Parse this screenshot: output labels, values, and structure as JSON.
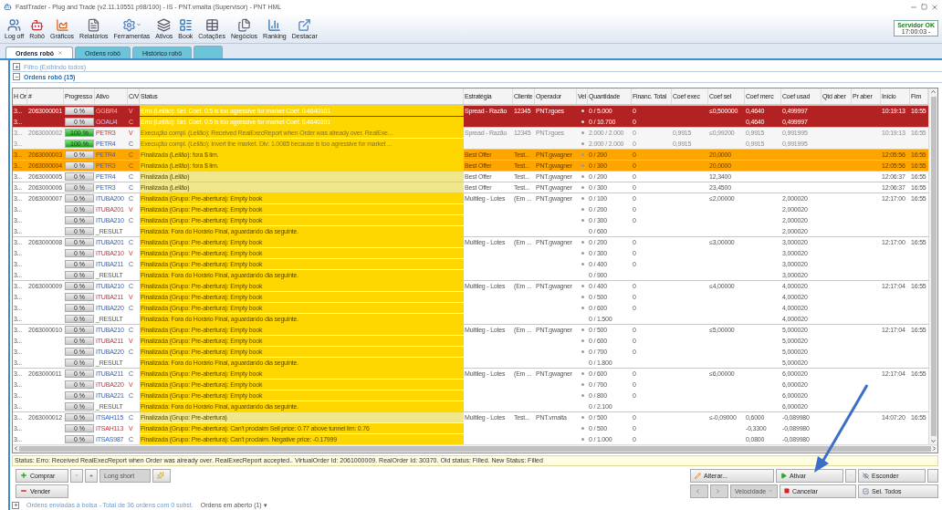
{
  "window": {
    "title": "FastTrader - Plug and Trade (v2.11.10551 p98/100) - IS - PNT.vmalta (Supervisor) - PNT HML"
  },
  "toolbar": [
    {
      "label": "Log off",
      "has_menu": false
    },
    {
      "label": "Robô",
      "has_menu": false
    },
    {
      "label": "Gráficos",
      "has_menu": false
    },
    {
      "label": "Relatórios",
      "has_menu": false
    },
    {
      "label": "Ferramentas",
      "has_menu": true
    },
    {
      "label": "Ativos",
      "has_menu": false
    },
    {
      "label": "Book",
      "has_menu": false
    },
    {
      "label": "Cotações",
      "has_menu": false
    },
    {
      "label": "Negócios",
      "has_menu": false
    },
    {
      "label": "Ranking",
      "has_menu": false
    },
    {
      "label": "Destacar",
      "has_menu": false
    }
  ],
  "server": {
    "status": "Servidor OK",
    "time": "17:00:03 -"
  },
  "tabs": [
    {
      "label": "Ordens robô",
      "selected": true,
      "closable": true
    },
    {
      "label": "Ordens robô",
      "selected": false,
      "closable": false
    },
    {
      "label": "Histórico robô",
      "selected": false,
      "closable": false
    }
  ],
  "filter": {
    "label": "Filtro (Exibindo todos)",
    "expanded": false
  },
  "orders_panel": {
    "label": "Ordens robô (15)",
    "expanded": true
  },
  "columns": [
    "H Or",
    "#",
    "Progresso",
    "Ativo",
    "C/V",
    "Status",
    "Estratégia",
    "Cliente",
    "Operador",
    "Vel",
    "Quantidade",
    "Financ. Total",
    "Coef exec",
    "Coef sel",
    "Coef merc",
    "Coef usad",
    "Qtd aber",
    "Pr aber",
    "Início",
    "Fim"
  ],
  "rows": [
    {
      "hash": "3...",
      "id": "2063000001",
      "level": 0,
      "progress": "0 %",
      "ativo": "GGBR4",
      "side": "V",
      "status": "Erro (Leilão): Sel. Coef. 0.5 is too agressive for market Coef. 0.4640101",
      "strategy": "Spread - Razão",
      "client": "12345",
      "operator": "PNT.rgoes",
      "vel": true,
      "qty": "0 / 5.000",
      "fin": "0",
      "coef_sel": "≤0,500000",
      "coef_merc": "0,4640",
      "coef_usad": "0,499997",
      "start": "10:19:13",
      "end": "16:55",
      "kind": "error",
      "status_pale": false,
      "group_start": true
    },
    {
      "hash": "3...",
      "level": 0,
      "progress": "0 %",
      "ativo": "GOAU4",
      "side": "C",
      "status": "Erro (Leilão): Sel. Coef. 0.5 is too agressive for market Coef. 0.4640101",
      "vel": true,
      "qty": "0 / 10.700",
      "fin": "0",
      "coef_merc": "0,4640",
      "coef_usad": "0,499997",
      "kind": "error",
      "status_pale": false,
      "group_start": false
    },
    {
      "hash": "3...",
      "id": "2063000002",
      "level": 1,
      "progress": "100 %",
      "ativo": "PETR3",
      "side": "V",
      "status": "Execução compl. (Leilão): Received RealExecReport when Order was already over. RealExe...",
      "strategy": "Spread - Razão",
      "client": "12345",
      "operator": "PNT.rgoes",
      "vel": true,
      "qty": "2.000 / 2.000",
      "fin": "0",
      "coef_exec": "0,9915",
      "coef_sel": "≤0,99200",
      "coef_merc": "0,9915",
      "coef_usad": "0,991995",
      "start": "10:19:13",
      "end": "16:55",
      "kind": "done",
      "status_pale": false,
      "group_start": true
    },
    {
      "hash": "3...",
      "level": 1,
      "progress": "100 %",
      "ativo": "PETR4",
      "side": "C",
      "status": "Execução compl. (Leilão): Invert the market. Div: 1.0085 because is too agressive for market ...",
      "vel": true,
      "qty": "2.000 / 2.000",
      "fin": "0",
      "coef_exec": "0,9915",
      "coef_merc": "0,9915",
      "coef_usad": "0,991995",
      "kind": "done",
      "status_pale": false,
      "group_start": false
    },
    {
      "hash": "3...",
      "id": "2063000003",
      "level": 0,
      "progress": "0 %",
      "ativo": "PETR4",
      "side": "C",
      "status": "Finalizada (Leilão): fora $ lim.",
      "strategy": "Best Offer",
      "client": "Test...",
      "operator": "PNT.gwagner",
      "vel": true,
      "qty": "0 / 200",
      "fin": "0",
      "coef_sel": "20,0000",
      "start": "12:05:56",
      "end": "16:55",
      "kind": "warning",
      "status_pale": false,
      "group_start": true
    },
    {
      "hash": "3...",
      "id": "2063000004",
      "level": 0,
      "progress": "0 %",
      "ativo": "PETR3",
      "side": "C",
      "status": "Finalizada (Leilão): fora $ lim.",
      "strategy": "Best Offer",
      "client": "Test...",
      "operator": "PNT.gwagner",
      "vel": true,
      "qty": "0 / 300",
      "fin": "0",
      "coef_sel": "20,0000",
      "start": "12:05:56",
      "end": "16:55",
      "kind": "warning",
      "status_pale": false,
      "group_start": true
    },
    {
      "hash": "3...",
      "id": "2063000005",
      "level": 0,
      "progress": "0 %",
      "ativo": "PETR4",
      "side": "C",
      "status": "Finalizada (Leilão)",
      "strategy": "Best Offer",
      "client": "Test...",
      "operator": "PNT.gwagner",
      "vel": true,
      "qty": "0 / 200",
      "fin": "0",
      "coef_sel": "12,3400",
      "start": "12:06:37",
      "end": "16:55",
      "kind": "normal",
      "status_pale": true,
      "group_start": true
    },
    {
      "hash": "3...",
      "id": "2063000006",
      "level": 0,
      "progress": "0 %",
      "ativo": "PETR3",
      "side": "C",
      "status": "Finalizada (Leilão)",
      "strategy": "Best Offer",
      "client": "Test...",
      "operator": "PNT.gwagner",
      "vel": true,
      "qty": "0 / 300",
      "fin": "0",
      "coef_sel": "23,4500",
      "start": "12:06:37",
      "end": "16:55",
      "kind": "normal",
      "status_pale": true,
      "group_start": true
    },
    {
      "hash": "3...",
      "id": "2063000007",
      "level": 0,
      "progress": "0 %",
      "ativo": "ITUBA200",
      "side": "C",
      "status": "Finalizada (Grupo: Pre-abertura): Empty book",
      "strategy": "Multileg - Lotes",
      "client": "(Em ...",
      "operator": "PNT.gwagner",
      "vel": true,
      "qty": "0 / 100",
      "fin": "0",
      "coef_sel": "≤2,00000",
      "coef_usad": "2,000020",
      "start": "12:17:00",
      "end": "16:55",
      "kind": "normal",
      "status_pale": false,
      "group_start": true
    },
    {
      "hash": "3...",
      "level": 0,
      "progress": "0 %",
      "ativo": "ITUBA201",
      "side": "V",
      "status": "Finalizada (Grupo: Pre-abertura): Empty book",
      "vel": true,
      "qty": "0 / 200",
      "fin": "0",
      "coef_usad": "2,000020",
      "kind": "normal",
      "status_pale": false,
      "group_start": false
    },
    {
      "hash": "3...",
      "level": 0,
      "progress": "0 %",
      "ativo": "ITUBA210",
      "side": "C",
      "status": "Finalizada (Grupo: Pre-abertura): Empty book",
      "vel": true,
      "qty": "0 / 300",
      "fin": "0",
      "coef_usad": "2,000020",
      "kind": "normal",
      "status_pale": false,
      "group_start": false
    },
    {
      "hash": "3...",
      "level": 0,
      "progress": "0 %",
      "ativo": "_RESULT",
      "status": "Finalizada: Fora do Horário Final, aguardando dia seguinte.",
      "vel": false,
      "qty": "0 / 600",
      "coef_usad": "2,000020",
      "kind": "normal",
      "status_pale": false,
      "group_start": false
    },
    {
      "hash": "3...",
      "id": "2063000008",
      "level": 0,
      "progress": "0 %",
      "ativo": "ITUBA201",
      "side": "C",
      "status": "Finalizada (Grupo: Pre-abertura): Empty book",
      "strategy": "Multileg - Lotes",
      "client": "(Em ...",
      "operator": "PNT.gwagner",
      "vel": true,
      "qty": "0 / 200",
      "fin": "0",
      "coef_sel": "≤3,00000",
      "coef_usad": "3,000020",
      "start": "12:17:00",
      "end": "16:55",
      "kind": "normal",
      "status_pale": false,
      "group_start": true
    },
    {
      "hash": "3...",
      "level": 0,
      "progress": "0 %",
      "ativo": "ITUBA210",
      "side": "V",
      "status": "Finalizada (Grupo: Pre-abertura): Empty book",
      "vel": true,
      "qty": "0 / 300",
      "fin": "0",
      "coef_usad": "3,000020",
      "kind": "normal",
      "status_pale": false,
      "group_start": false
    },
    {
      "hash": "3...",
      "level": 0,
      "progress": "0 %",
      "ativo": "ITUBA211",
      "side": "C",
      "status": "Finalizada (Grupo: Pre-abertura): Empty book",
      "vel": true,
      "qty": "0 / 400",
      "fin": "0",
      "coef_usad": "3,000020",
      "kind": "normal",
      "status_pale": false,
      "group_start": false
    },
    {
      "hash": "3...",
      "level": 0,
      "progress": "0 %",
      "ativo": "_RESULT",
      "status": "Finalizada: Fora do Horário Final, aguardando dia seguinte.",
      "vel": false,
      "qty": "0 / 900",
      "coef_usad": "3,000020",
      "kind": "normal",
      "status_pale": false,
      "group_start": false
    },
    {
      "hash": "3...",
      "id": "2063000009",
      "level": 0,
      "progress": "0 %",
      "ativo": "ITUBA210",
      "side": "C",
      "status": "Finalizada (Grupo: Pre-abertura): Empty book",
      "strategy": "Multileg - Lotes",
      "client": "(Em ...",
      "operator": "PNT.gwagner",
      "vel": true,
      "qty": "0 / 400",
      "fin": "0",
      "coef_sel": "≤4,00000",
      "coef_usad": "4,000020",
      "start": "12:17:04",
      "end": "16:55",
      "kind": "normal",
      "status_pale": false,
      "group_start": true
    },
    {
      "hash": "3...",
      "level": 0,
      "progress": "0 %",
      "ativo": "ITUBA211",
      "side": "V",
      "status": "Finalizada (Grupo: Pre-abertura): Empty book",
      "vel": true,
      "qty": "0 / 500",
      "fin": "0",
      "coef_usad": "4,000020",
      "kind": "normal",
      "status_pale": false,
      "group_start": false
    },
    {
      "hash": "3...",
      "level": 0,
      "progress": "0 %",
      "ativo": "ITUBA220",
      "side": "C",
      "status": "Finalizada (Grupo: Pre-abertura): Empty book",
      "vel": true,
      "qty": "0 / 600",
      "fin": "0",
      "coef_usad": "4,000020",
      "kind": "normal",
      "status_pale": false,
      "group_start": false
    },
    {
      "hash": "3...",
      "level": 0,
      "progress": "0 %",
      "ativo": "_RESULT",
      "status": "Finalizada: Fora do Horário Final, aguardando dia seguinte.",
      "vel": false,
      "qty": "0 / 1.500",
      "coef_usad": "4,000020",
      "kind": "normal",
      "status_pale": false,
      "group_start": false
    },
    {
      "hash": "3...",
      "id": "2063000010",
      "level": 0,
      "progress": "0 %",
      "ativo": "ITUBA210",
      "side": "C",
      "status": "Finalizada (Grupo: Pre-abertura): Empty book",
      "strategy": "Multileg - Lotes",
      "client": "(Em ...",
      "operator": "PNT.gwagner",
      "vel": true,
      "qty": "0 / 500",
      "fin": "0",
      "coef_sel": "≤5,00000",
      "coef_usad": "5,000020",
      "start": "12:17:04",
      "end": "16:55",
      "kind": "normal",
      "status_pale": false,
      "group_start": true
    },
    {
      "hash": "3...",
      "level": 0,
      "progress": "0 %",
      "ativo": "ITUBA211",
      "side": "V",
      "status": "Finalizada (Grupo: Pre-abertura): Empty book",
      "vel": true,
      "qty": "0 / 600",
      "fin": "0",
      "coef_usad": "5,000020",
      "kind": "normal",
      "status_pale": false,
      "group_start": false
    },
    {
      "hash": "3...",
      "level": 0,
      "progress": "0 %",
      "ativo": "ITUBA220",
      "side": "C",
      "status": "Finalizada (Grupo: Pre-abertura): Empty book",
      "vel": true,
      "qty": "0 / 700",
      "fin": "0",
      "coef_usad": "5,000020",
      "kind": "normal",
      "status_pale": false,
      "group_start": false
    },
    {
      "hash": "3...",
      "level": 0,
      "progress": "0 %",
      "ativo": "_RESULT",
      "status": "Finalizada: Fora do Horário Final, aguardando dia seguinte.",
      "vel": false,
      "qty": "0 / 1.800",
      "coef_usad": "5,000020",
      "kind": "normal",
      "status_pale": false,
      "group_start": false
    },
    {
      "hash": "3...",
      "id": "2063000011",
      "level": 0,
      "progress": "0 %",
      "ativo": "ITUBA211",
      "side": "C",
      "status": "Finalizada (Grupo: Pre-abertura): Empty book",
      "strategy": "Multileg - Lotes",
      "client": "(Em ...",
      "operator": "PNT.gwagner",
      "vel": true,
      "qty": "0 / 600",
      "fin": "0",
      "coef_sel": "≤6,00000",
      "coef_usad": "6,000020",
      "start": "12:17:04",
      "end": "16:55",
      "kind": "normal",
      "status_pale": false,
      "group_start": true
    },
    {
      "hash": "3...",
      "level": 0,
      "progress": "0 %",
      "ativo": "ITUBA220",
      "side": "V",
      "status": "Finalizada (Grupo: Pre-abertura): Empty book",
      "vel": true,
      "qty": "0 / 700",
      "fin": "0",
      "coef_usad": "6,000020",
      "kind": "normal",
      "status_pale": false,
      "group_start": false
    },
    {
      "hash": "3...",
      "level": 0,
      "progress": "0 %",
      "ativo": "ITUBA221",
      "side": "C",
      "status": "Finalizada (Grupo: Pre-abertura): Empty book",
      "vel": true,
      "qty": "0 / 800",
      "fin": "0",
      "coef_usad": "6,000020",
      "kind": "normal",
      "status_pale": false,
      "group_start": false
    },
    {
      "hash": "3...",
      "level": 0,
      "progress": "0 %",
      "ativo": "_RESULT",
      "status": "Finalizada: Fora do Horário Final, aguardando dia seguinte.",
      "vel": false,
      "qty": "0 / 2.100",
      "coef_usad": "6,000020",
      "kind": "normal",
      "status_pale": false,
      "group_start": false
    },
    {
      "hash": "3...",
      "id": "2063000012",
      "level": 0,
      "progress": "0 %",
      "ativo": "ITSAH115",
      "side": "C",
      "status": "Finalizada (Grupo: Pre-abertura)",
      "strategy": "Multileg - Lotes",
      "client": "Test...",
      "operator": "PNT.vmalta",
      "vel": true,
      "qty": "0 / 500",
      "fin": "0",
      "coef_sel": "≤-0,09000",
      "coef_merc": "0,6000",
      "coef_usad": "-0,089980",
      "start": "14:07:20",
      "end": "16:55",
      "kind": "normal",
      "status_pale": true,
      "group_start": true
    },
    {
      "hash": "3...",
      "level": 0,
      "progress": "0 %",
      "ativo": "ITSAH113",
      "side": "V",
      "status": "Finalizada (Grupo: Pre-abertura): Can't proclaim Sell price: 0.77 above tunnel lim: 0.76",
      "vel": true,
      "qty": "0 / 500",
      "fin": "0",
      "coef_merc": "-0,3300",
      "coef_usad": "-0,089980",
      "kind": "normal",
      "status_pale": false,
      "group_start": false
    },
    {
      "hash": "3...",
      "level": 0,
      "progress": "0 %",
      "ativo": "ITSAS987",
      "side": "C",
      "status": "Finalizada (Grupo: Pre-abertura): Can't proclaim. Negative price: -0.17999",
      "vel": true,
      "qty": "0 / 1.000",
      "fin": "0",
      "coef_merc": "0,0800",
      "coef_usad": "-0,089980",
      "kind": "normal",
      "status_pale": false,
      "group_start": false
    }
  ],
  "status_line": "Status: Erro: Received RealExecReport when Order was already over. RealExecReport accepted.. VirtualOrder Id: 2061000009. RealOrder Id: 30370. Old status: Filled. New Status: Filled",
  "actions": {
    "buy": "Comprar",
    "sell": "Vender",
    "long_short": {
      "label": "Long short",
      "disabled": true
    },
    "alter": "Alterar...",
    "activate": "Ativar",
    "hide": "Esconder",
    "speed": {
      "label": "Velocidade",
      "disabled": true
    },
    "cancel": "Cancelar",
    "select_all": "Sel. Todos"
  },
  "footer": {
    "sent": "Ordens enviadas à bolsa - Total de 36 ordens com 0 subst.",
    "open": "Ordens em aberto (1) ▾",
    "expanded": false
  }
}
